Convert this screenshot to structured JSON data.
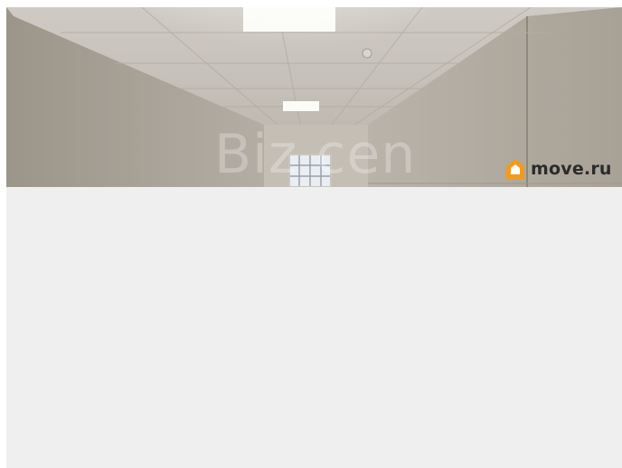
{
  "photo": {
    "watermark_text": "Biz cen"
  },
  "brand": {
    "logo_text": "move.ru",
    "icon": "house-icon",
    "accent_color": "#f39a1e"
  }
}
